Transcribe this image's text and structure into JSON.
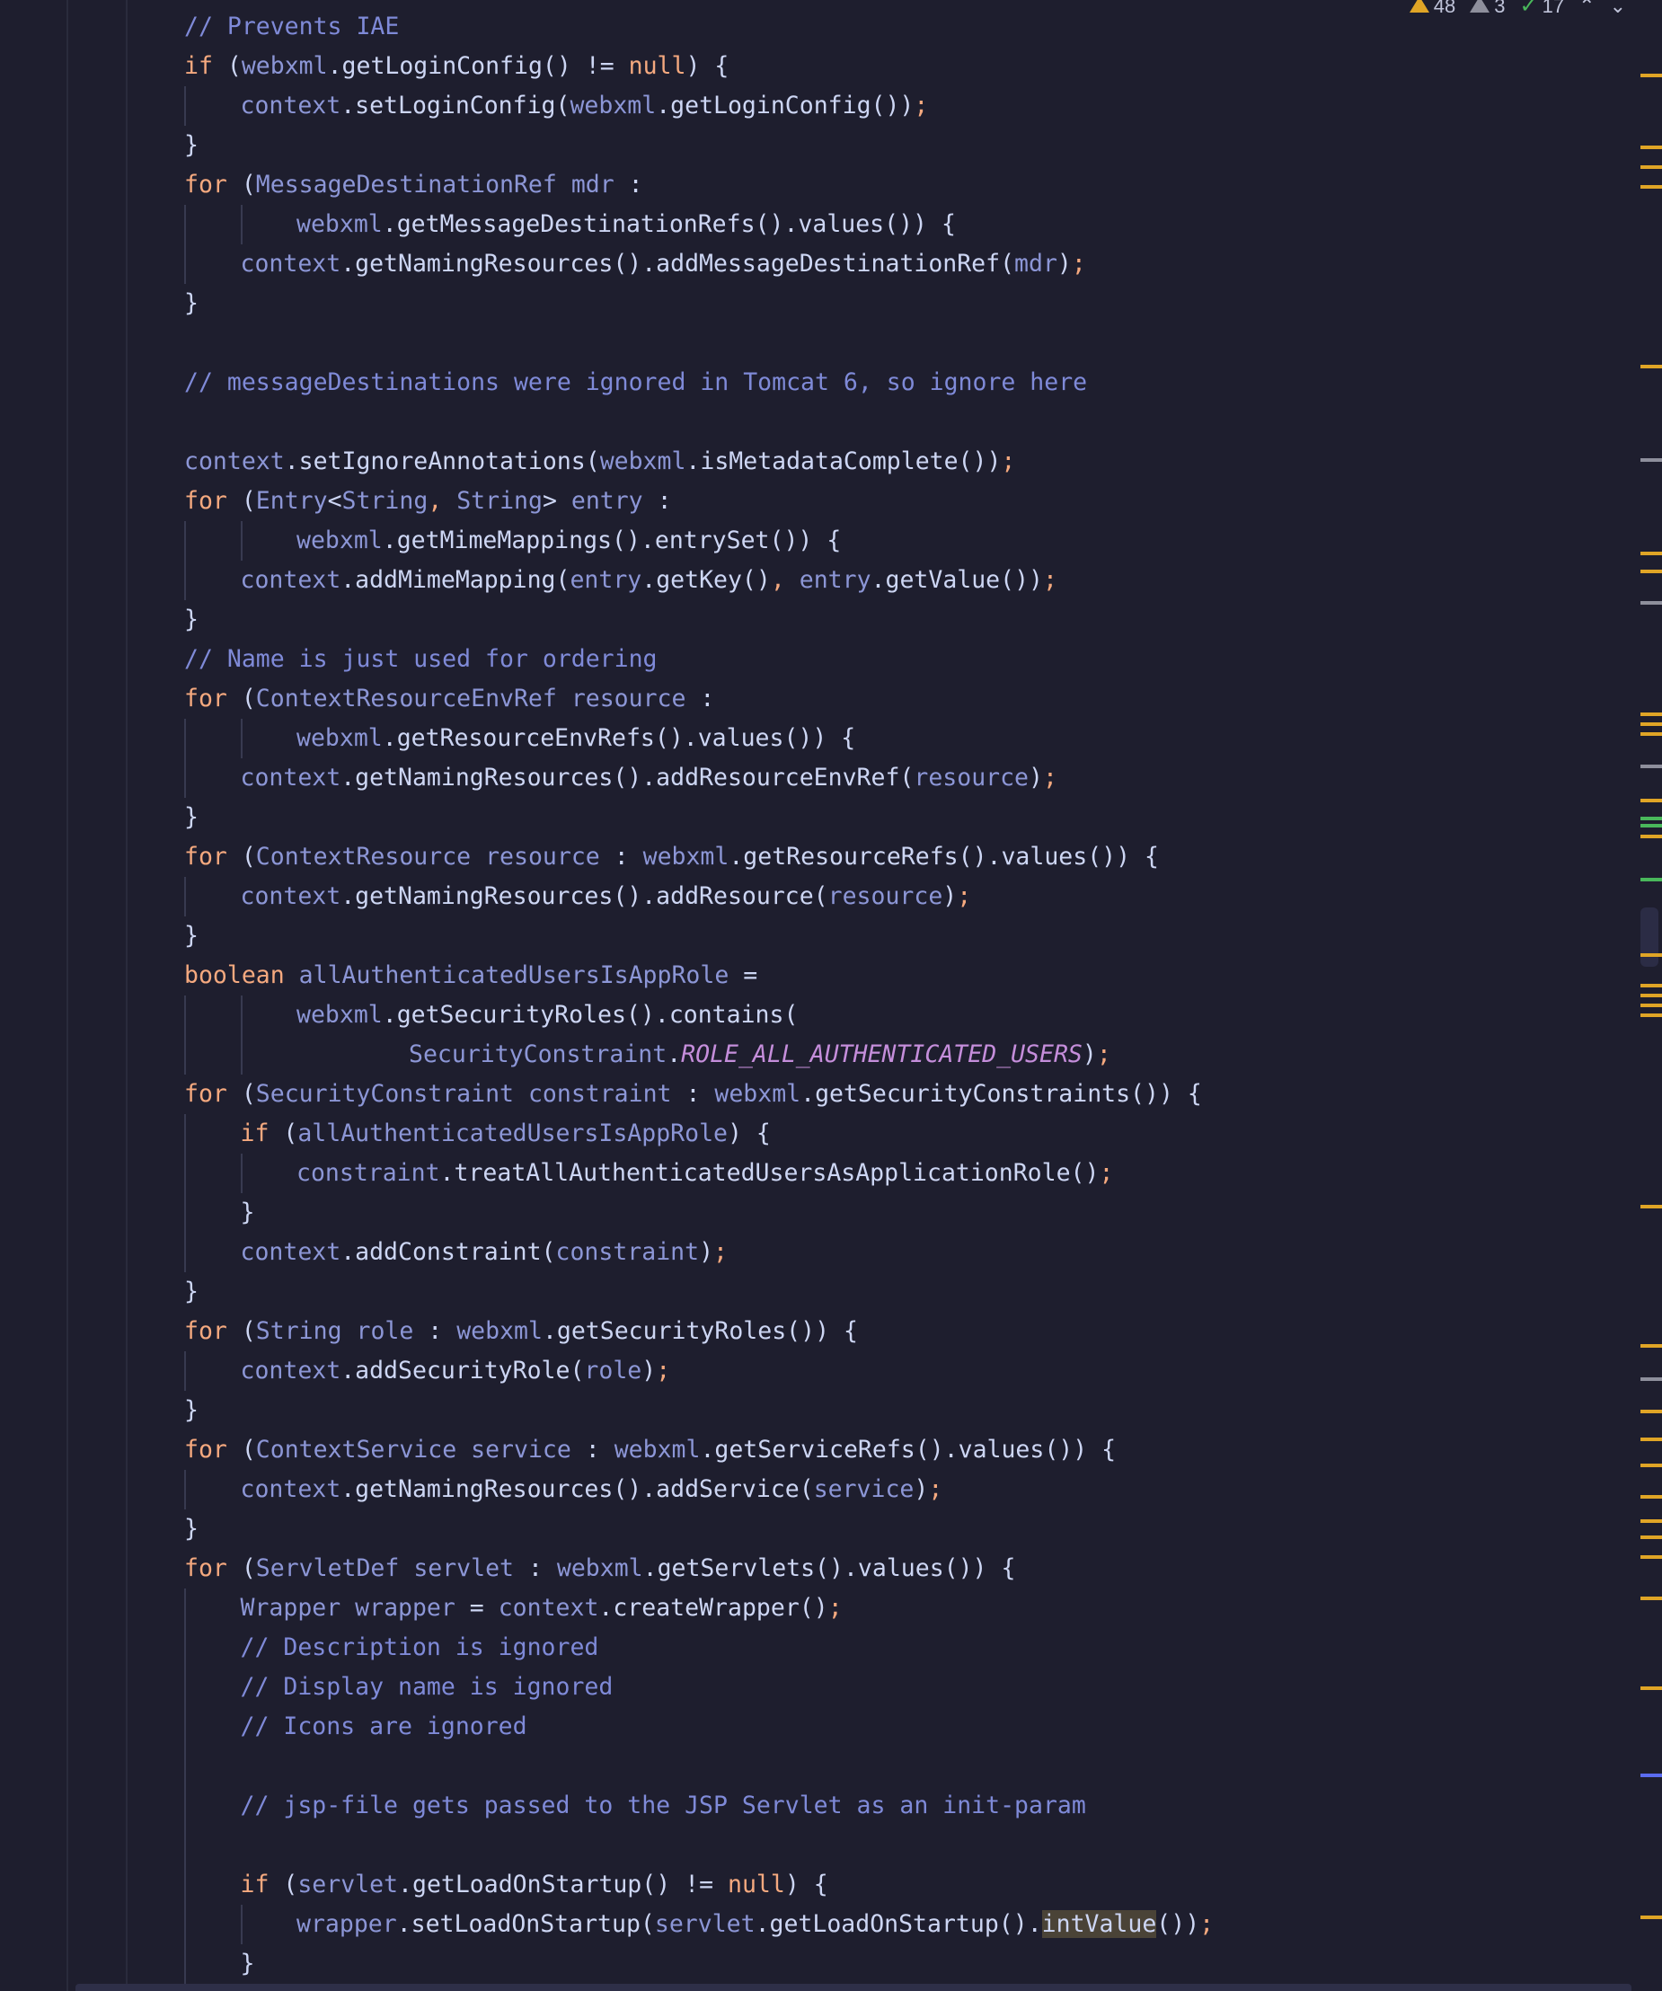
{
  "status": {
    "warnings": "48",
    "weak_warnings": "3",
    "typos": "17"
  },
  "code": {
    "lines": [
      {
        "indent": 0,
        "tokens": [
          [
            "cmt",
            "// Prevents IAE"
          ]
        ]
      },
      {
        "indent": 0,
        "tokens": [
          [
            "kw",
            "if"
          ],
          [
            "punc",
            " ("
          ],
          [
            "fld",
            "webxml"
          ],
          [
            "punc",
            ".getLoginConfig() != "
          ],
          [
            "kw",
            "null"
          ],
          [
            "punc",
            ") {"
          ]
        ]
      },
      {
        "indent": 1,
        "tokens": [
          [
            "fld",
            "context"
          ],
          [
            "punc",
            ".setLoginConfig("
          ],
          [
            "fld",
            "webxml"
          ],
          [
            "punc",
            ".getLoginConfig())"
          ],
          [
            "semi",
            ";"
          ]
        ]
      },
      {
        "indent": 0,
        "tokens": [
          [
            "punc",
            "}"
          ]
        ]
      },
      {
        "indent": 0,
        "tokens": [
          [
            "kw",
            "for"
          ],
          [
            "punc",
            " ("
          ],
          [
            "typ",
            "MessageDestinationRef"
          ],
          [
            "punc",
            " "
          ],
          [
            "fld",
            "mdr"
          ],
          [
            "punc",
            " :"
          ]
        ]
      },
      {
        "indent": 2,
        "tokens": [
          [
            "fld",
            "webxml"
          ],
          [
            "punc",
            ".getMessageDestinationRefs().values()) {"
          ]
        ]
      },
      {
        "indent": 1,
        "tokens": [
          [
            "fld",
            "context"
          ],
          [
            "punc",
            ".getNamingResources().addMessageDestinationRef("
          ],
          [
            "fld",
            "mdr"
          ],
          [
            "punc",
            ")"
          ],
          [
            "semi",
            ";"
          ]
        ]
      },
      {
        "indent": 0,
        "tokens": [
          [
            "punc",
            "}"
          ]
        ]
      },
      {
        "indent": 0,
        "tokens": []
      },
      {
        "indent": 0,
        "tokens": [
          [
            "cmt",
            "// messageDestinations were ignored in Tomcat 6, so ignore here"
          ]
        ]
      },
      {
        "indent": 0,
        "tokens": []
      },
      {
        "indent": 0,
        "tokens": [
          [
            "fld",
            "context"
          ],
          [
            "punc",
            ".setIgnoreAnnotations("
          ],
          [
            "fld",
            "webxml"
          ],
          [
            "punc",
            ".isMetadataComplete())"
          ],
          [
            "semi",
            ";"
          ]
        ]
      },
      {
        "indent": 0,
        "tokens": [
          [
            "kw",
            "for"
          ],
          [
            "punc",
            " ("
          ],
          [
            "typ",
            "Entry"
          ],
          [
            "punc",
            "<"
          ],
          [
            "typ",
            "String"
          ],
          [
            "semi",
            ", "
          ],
          [
            "typ",
            "String"
          ],
          [
            "punc",
            "> "
          ],
          [
            "fld",
            "entry"
          ],
          [
            "punc",
            " :"
          ]
        ]
      },
      {
        "indent": 2,
        "tokens": [
          [
            "fld",
            "webxml"
          ],
          [
            "punc",
            ".getMimeMappings().entrySet()) {"
          ]
        ]
      },
      {
        "indent": 1,
        "tokens": [
          [
            "fld",
            "context"
          ],
          [
            "punc",
            ".addMimeMapping("
          ],
          [
            "fld",
            "entry"
          ],
          [
            "punc",
            ".getKey()"
          ],
          [
            "semi",
            ", "
          ],
          [
            "fld",
            "entry"
          ],
          [
            "punc",
            ".getValue())"
          ],
          [
            "semi",
            ";"
          ]
        ]
      },
      {
        "indent": 0,
        "tokens": [
          [
            "punc",
            "}"
          ]
        ]
      },
      {
        "indent": 0,
        "tokens": [
          [
            "cmt",
            "// Name is just used for ordering"
          ]
        ]
      },
      {
        "indent": 0,
        "tokens": [
          [
            "kw",
            "for"
          ],
          [
            "punc",
            " ("
          ],
          [
            "typ",
            "ContextResourceEnvRef"
          ],
          [
            "punc",
            " "
          ],
          [
            "fld",
            "resource"
          ],
          [
            "punc",
            " :"
          ]
        ]
      },
      {
        "indent": 2,
        "tokens": [
          [
            "fld",
            "webxml"
          ],
          [
            "punc",
            ".getResourceEnvRefs().values()) {"
          ]
        ]
      },
      {
        "indent": 1,
        "tokens": [
          [
            "fld",
            "context"
          ],
          [
            "punc",
            ".getNamingResources().addResourceEnvRef("
          ],
          [
            "fld",
            "resource"
          ],
          [
            "punc",
            ")"
          ],
          [
            "semi",
            ";"
          ]
        ]
      },
      {
        "indent": 0,
        "tokens": [
          [
            "punc",
            "}"
          ]
        ]
      },
      {
        "indent": 0,
        "tokens": [
          [
            "kw",
            "for"
          ],
          [
            "punc",
            " ("
          ],
          [
            "typ",
            "ContextResource"
          ],
          [
            "punc",
            " "
          ],
          [
            "fld",
            "resource"
          ],
          [
            "punc",
            " : "
          ],
          [
            "fld",
            "webxml"
          ],
          [
            "punc",
            ".getResourceRefs().values()) {"
          ]
        ]
      },
      {
        "indent": 1,
        "tokens": [
          [
            "fld",
            "context"
          ],
          [
            "punc",
            ".getNamingResources().addResource("
          ],
          [
            "fld",
            "resource"
          ],
          [
            "punc",
            ")"
          ],
          [
            "semi",
            ";"
          ]
        ]
      },
      {
        "indent": 0,
        "tokens": [
          [
            "punc",
            "}"
          ]
        ]
      },
      {
        "indent": 0,
        "tokens": [
          [
            "kw",
            "boolean"
          ],
          [
            "punc",
            " "
          ],
          [
            "fld",
            "allAuthenticatedUsersIsAppRole"
          ],
          [
            "punc",
            " ="
          ]
        ]
      },
      {
        "indent": 2,
        "tokens": [
          [
            "fld",
            "webxml"
          ],
          [
            "punc",
            ".getSecurityRoles().contains("
          ]
        ]
      },
      {
        "indent": 4,
        "tokens": [
          [
            "typ",
            "SecurityConstraint"
          ],
          [
            "punc",
            "."
          ],
          [
            "const",
            "ROLE_ALL_AUTHENTICATED_USERS"
          ],
          [
            "punc",
            ")"
          ],
          [
            "semi",
            ";"
          ]
        ]
      },
      {
        "indent": 0,
        "tokens": [
          [
            "kw",
            "for"
          ],
          [
            "punc",
            " ("
          ],
          [
            "typ",
            "SecurityConstraint"
          ],
          [
            "punc",
            " "
          ],
          [
            "fld",
            "constraint"
          ],
          [
            "punc",
            " : "
          ],
          [
            "fld",
            "webxml"
          ],
          [
            "punc",
            ".getSecurityConstraints()) {"
          ]
        ]
      },
      {
        "indent": 1,
        "tokens": [
          [
            "kw",
            "if"
          ],
          [
            "punc",
            " ("
          ],
          [
            "fld",
            "allAuthenticatedUsersIsAppRole"
          ],
          [
            "punc",
            ") {"
          ]
        ]
      },
      {
        "indent": 2,
        "tokens": [
          [
            "fld",
            "constraint"
          ],
          [
            "punc",
            ".treatAllAuthenticatedUsersAsApplicationRole()"
          ],
          [
            "semi",
            ";"
          ]
        ]
      },
      {
        "indent": 1,
        "tokens": [
          [
            "punc",
            "}"
          ]
        ]
      },
      {
        "indent": 1,
        "tokens": [
          [
            "fld",
            "context"
          ],
          [
            "punc",
            ".addConstraint("
          ],
          [
            "fld",
            "constraint"
          ],
          [
            "punc",
            ")"
          ],
          [
            "semi",
            ";"
          ]
        ]
      },
      {
        "indent": 0,
        "tokens": [
          [
            "punc",
            "}"
          ]
        ]
      },
      {
        "indent": 0,
        "tokens": [
          [
            "kw",
            "for"
          ],
          [
            "punc",
            " ("
          ],
          [
            "typ",
            "String"
          ],
          [
            "punc",
            " "
          ],
          [
            "fld",
            "role"
          ],
          [
            "punc",
            " : "
          ],
          [
            "fld",
            "webxml"
          ],
          [
            "punc",
            ".getSecurityRoles()) {"
          ]
        ]
      },
      {
        "indent": 1,
        "tokens": [
          [
            "fld",
            "context"
          ],
          [
            "punc",
            ".addSecurityRole("
          ],
          [
            "fld",
            "role"
          ],
          [
            "punc",
            ")"
          ],
          [
            "semi",
            ";"
          ]
        ]
      },
      {
        "indent": 0,
        "tokens": [
          [
            "punc",
            "}"
          ]
        ]
      },
      {
        "indent": 0,
        "tokens": [
          [
            "kw",
            "for"
          ],
          [
            "punc",
            " ("
          ],
          [
            "typ",
            "ContextService"
          ],
          [
            "punc",
            " "
          ],
          [
            "fld",
            "service"
          ],
          [
            "punc",
            " : "
          ],
          [
            "fld",
            "webxml"
          ],
          [
            "punc",
            ".getServiceRefs().values()) {"
          ]
        ]
      },
      {
        "indent": 1,
        "tokens": [
          [
            "fld",
            "context"
          ],
          [
            "punc",
            ".getNamingResources().addService("
          ],
          [
            "fld",
            "service"
          ],
          [
            "punc",
            ")"
          ],
          [
            "semi",
            ";"
          ]
        ]
      },
      {
        "indent": 0,
        "tokens": [
          [
            "punc",
            "}"
          ]
        ]
      },
      {
        "indent": 0,
        "tokens": [
          [
            "kw",
            "for"
          ],
          [
            "punc",
            " ("
          ],
          [
            "typ",
            "ServletDef"
          ],
          [
            "punc",
            " "
          ],
          [
            "fld",
            "servlet"
          ],
          [
            "punc",
            " : "
          ],
          [
            "fld",
            "webxml"
          ],
          [
            "punc",
            ".getServlets().values()) {"
          ]
        ]
      },
      {
        "indent": 1,
        "tokens": [
          [
            "typ",
            "Wrapper"
          ],
          [
            "punc",
            " "
          ],
          [
            "fld",
            "wrapper"
          ],
          [
            "punc",
            " = "
          ],
          [
            "fld",
            "context"
          ],
          [
            "punc",
            ".createWrapper()"
          ],
          [
            "semi",
            ";"
          ]
        ]
      },
      {
        "indent": 1,
        "tokens": [
          [
            "cmt",
            "// Description is ignored"
          ]
        ]
      },
      {
        "indent": 1,
        "tokens": [
          [
            "cmt",
            "// Display name is ignored"
          ]
        ]
      },
      {
        "indent": 1,
        "tokens": [
          [
            "cmt",
            "// Icons are ignored"
          ]
        ]
      },
      {
        "indent": 1,
        "tokens": []
      },
      {
        "indent": 1,
        "tokens": [
          [
            "cmt",
            "// jsp-file gets passed to the JSP Servlet as an init-param"
          ]
        ]
      },
      {
        "indent": 1,
        "tokens": []
      },
      {
        "indent": 1,
        "tokens": [
          [
            "kw",
            "if"
          ],
          [
            "punc",
            " ("
          ],
          [
            "fld",
            "servlet"
          ],
          [
            "punc",
            ".getLoadOnStartup() != "
          ],
          [
            "kw",
            "null"
          ],
          [
            "punc",
            ") {"
          ]
        ]
      },
      {
        "indent": 2,
        "tokens": [
          [
            "fld",
            "wrapper"
          ],
          [
            "punc",
            ".setLoadOnStartup("
          ],
          [
            "fld",
            "servlet"
          ],
          [
            "punc",
            ".getLoadOnStartup()."
          ],
          [
            "hl",
            "intValue"
          ],
          [
            "punc",
            "())"
          ],
          [
            "semi",
            ";"
          ]
        ]
      },
      {
        "indent": 1,
        "tokens": [
          [
            "punc",
            "}"
          ]
        ]
      }
    ]
  },
  "colors": {
    "background": "#1e1e2e",
    "warning": "#e0a526",
    "weak": "#8e8f9c",
    "ok": "#49b85b",
    "info": "#5b6cf0"
  },
  "scrollbar_markers": [
    {
      "level": "warning",
      "pos": 0.037
    },
    {
      "level": "warning",
      "pos": 0.073
    },
    {
      "level": "warning",
      "pos": 0.083
    },
    {
      "level": "warning",
      "pos": 0.093
    },
    {
      "level": "warning",
      "pos": 0.183
    },
    {
      "level": "weak",
      "pos": 0.23
    },
    {
      "level": "warning",
      "pos": 0.277
    },
    {
      "level": "warning",
      "pos": 0.286
    },
    {
      "level": "weak",
      "pos": 0.302
    },
    {
      "level": "warning",
      "pos": 0.358
    },
    {
      "level": "warning",
      "pos": 0.363
    },
    {
      "level": "warning",
      "pos": 0.368
    },
    {
      "level": "weak",
      "pos": 0.384
    },
    {
      "level": "warning",
      "pos": 0.401
    },
    {
      "level": "ok",
      "pos": 0.41
    },
    {
      "level": "ok",
      "pos": 0.414
    },
    {
      "level": "warning",
      "pos": 0.419
    },
    {
      "level": "ok",
      "pos": 0.441
    },
    {
      "level": "warning",
      "pos": 0.479
    },
    {
      "level": "warning",
      "pos": 0.494
    },
    {
      "level": "warning",
      "pos": 0.499
    },
    {
      "level": "warning",
      "pos": 0.504
    },
    {
      "level": "warning",
      "pos": 0.509
    },
    {
      "level": "warning",
      "pos": 0.605
    },
    {
      "level": "warning",
      "pos": 0.675
    },
    {
      "level": "weak",
      "pos": 0.692
    },
    {
      "level": "warning",
      "pos": 0.708
    },
    {
      "level": "warning",
      "pos": 0.722
    },
    {
      "level": "warning",
      "pos": 0.735
    },
    {
      "level": "warning",
      "pos": 0.751
    },
    {
      "level": "warning",
      "pos": 0.763
    },
    {
      "level": "warning",
      "pos": 0.771
    },
    {
      "level": "warning",
      "pos": 0.781
    },
    {
      "level": "warning",
      "pos": 0.802
    },
    {
      "level": "warning",
      "pos": 0.847
    },
    {
      "level": "info",
      "pos": 0.891
    },
    {
      "level": "warning",
      "pos": 0.962
    }
  ]
}
